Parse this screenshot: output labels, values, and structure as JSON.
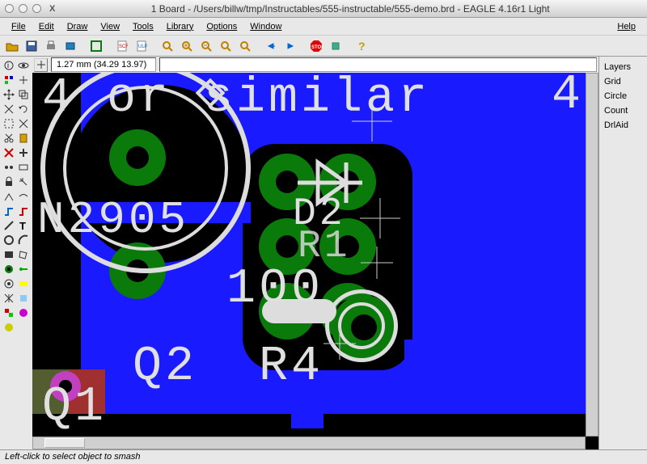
{
  "title": "1 Board - /Users/billw/tmp/Instructables/555-instructable/555-demo.brd - EAGLE 4.16r1 Light",
  "menus": [
    "File",
    "Edit",
    "Draw",
    "View",
    "Tools",
    "Library",
    "Options",
    "Window"
  ],
  "help": "Help",
  "coord": "1.27 mm (34.29 13.97)",
  "right_panel": [
    "Layers",
    "Grid",
    "Circle",
    "Count",
    "DrlAid"
  ],
  "status": "Left-click to select object to smash",
  "silk": {
    "top_text": "4 or similar",
    "left_label": "N2905",
    "r_val": "100",
    "d_label": "D2",
    "r1_label": "R1",
    "q2": "Q2",
    "q1": "Q1",
    "r4": "R4",
    "corner": "4"
  }
}
